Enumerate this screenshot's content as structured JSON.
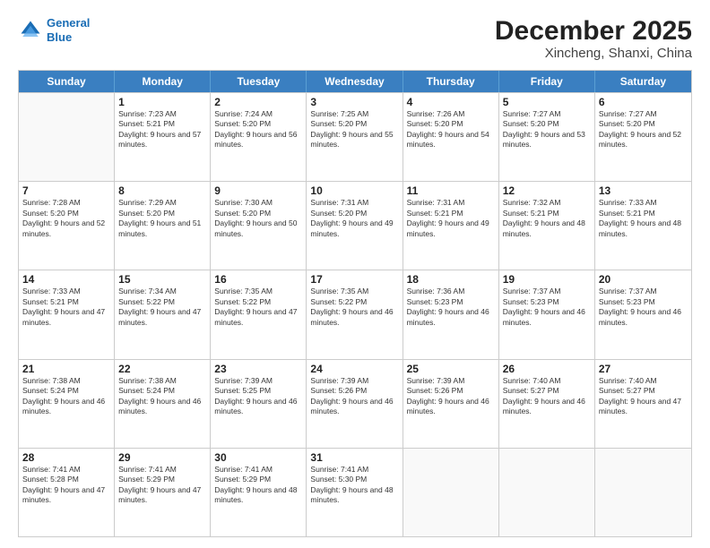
{
  "header": {
    "logo_line1": "General",
    "logo_line2": "Blue",
    "title": "December 2025",
    "subtitle": "Xincheng, Shanxi, China"
  },
  "calendar": {
    "days": [
      "Sunday",
      "Monday",
      "Tuesday",
      "Wednesday",
      "Thursday",
      "Friday",
      "Saturday"
    ],
    "rows": [
      [
        {
          "date": "",
          "sunrise": "",
          "sunset": "",
          "daylight": "",
          "empty": true
        },
        {
          "date": "1",
          "sunrise": "Sunrise: 7:23 AM",
          "sunset": "Sunset: 5:21 PM",
          "daylight": "Daylight: 9 hours and 57 minutes.",
          "empty": false
        },
        {
          "date": "2",
          "sunrise": "Sunrise: 7:24 AM",
          "sunset": "Sunset: 5:20 PM",
          "daylight": "Daylight: 9 hours and 56 minutes.",
          "empty": false
        },
        {
          "date": "3",
          "sunrise": "Sunrise: 7:25 AM",
          "sunset": "Sunset: 5:20 PM",
          "daylight": "Daylight: 9 hours and 55 minutes.",
          "empty": false
        },
        {
          "date": "4",
          "sunrise": "Sunrise: 7:26 AM",
          "sunset": "Sunset: 5:20 PM",
          "daylight": "Daylight: 9 hours and 54 minutes.",
          "empty": false
        },
        {
          "date": "5",
          "sunrise": "Sunrise: 7:27 AM",
          "sunset": "Sunset: 5:20 PM",
          "daylight": "Daylight: 9 hours and 53 minutes.",
          "empty": false
        },
        {
          "date": "6",
          "sunrise": "Sunrise: 7:27 AM",
          "sunset": "Sunset: 5:20 PM",
          "daylight": "Daylight: 9 hours and 52 minutes.",
          "empty": false
        }
      ],
      [
        {
          "date": "7",
          "sunrise": "Sunrise: 7:28 AM",
          "sunset": "Sunset: 5:20 PM",
          "daylight": "Daylight: 9 hours and 52 minutes.",
          "empty": false
        },
        {
          "date": "8",
          "sunrise": "Sunrise: 7:29 AM",
          "sunset": "Sunset: 5:20 PM",
          "daylight": "Daylight: 9 hours and 51 minutes.",
          "empty": false
        },
        {
          "date": "9",
          "sunrise": "Sunrise: 7:30 AM",
          "sunset": "Sunset: 5:20 PM",
          "daylight": "Daylight: 9 hours and 50 minutes.",
          "empty": false
        },
        {
          "date": "10",
          "sunrise": "Sunrise: 7:31 AM",
          "sunset": "Sunset: 5:20 PM",
          "daylight": "Daylight: 9 hours and 49 minutes.",
          "empty": false
        },
        {
          "date": "11",
          "sunrise": "Sunrise: 7:31 AM",
          "sunset": "Sunset: 5:21 PM",
          "daylight": "Daylight: 9 hours and 49 minutes.",
          "empty": false
        },
        {
          "date": "12",
          "sunrise": "Sunrise: 7:32 AM",
          "sunset": "Sunset: 5:21 PM",
          "daylight": "Daylight: 9 hours and 48 minutes.",
          "empty": false
        },
        {
          "date": "13",
          "sunrise": "Sunrise: 7:33 AM",
          "sunset": "Sunset: 5:21 PM",
          "daylight": "Daylight: 9 hours and 48 minutes.",
          "empty": false
        }
      ],
      [
        {
          "date": "14",
          "sunrise": "Sunrise: 7:33 AM",
          "sunset": "Sunset: 5:21 PM",
          "daylight": "Daylight: 9 hours and 47 minutes.",
          "empty": false
        },
        {
          "date": "15",
          "sunrise": "Sunrise: 7:34 AM",
          "sunset": "Sunset: 5:22 PM",
          "daylight": "Daylight: 9 hours and 47 minutes.",
          "empty": false
        },
        {
          "date": "16",
          "sunrise": "Sunrise: 7:35 AM",
          "sunset": "Sunset: 5:22 PM",
          "daylight": "Daylight: 9 hours and 47 minutes.",
          "empty": false
        },
        {
          "date": "17",
          "sunrise": "Sunrise: 7:35 AM",
          "sunset": "Sunset: 5:22 PM",
          "daylight": "Daylight: 9 hours and 46 minutes.",
          "empty": false
        },
        {
          "date": "18",
          "sunrise": "Sunrise: 7:36 AM",
          "sunset": "Sunset: 5:23 PM",
          "daylight": "Daylight: 9 hours and 46 minutes.",
          "empty": false
        },
        {
          "date": "19",
          "sunrise": "Sunrise: 7:37 AM",
          "sunset": "Sunset: 5:23 PM",
          "daylight": "Daylight: 9 hours and 46 minutes.",
          "empty": false
        },
        {
          "date": "20",
          "sunrise": "Sunrise: 7:37 AM",
          "sunset": "Sunset: 5:23 PM",
          "daylight": "Daylight: 9 hours and 46 minutes.",
          "empty": false
        }
      ],
      [
        {
          "date": "21",
          "sunrise": "Sunrise: 7:38 AM",
          "sunset": "Sunset: 5:24 PM",
          "daylight": "Daylight: 9 hours and 46 minutes.",
          "empty": false
        },
        {
          "date": "22",
          "sunrise": "Sunrise: 7:38 AM",
          "sunset": "Sunset: 5:24 PM",
          "daylight": "Daylight: 9 hours and 46 minutes.",
          "empty": false
        },
        {
          "date": "23",
          "sunrise": "Sunrise: 7:39 AM",
          "sunset": "Sunset: 5:25 PM",
          "daylight": "Daylight: 9 hours and 46 minutes.",
          "empty": false
        },
        {
          "date": "24",
          "sunrise": "Sunrise: 7:39 AM",
          "sunset": "Sunset: 5:26 PM",
          "daylight": "Daylight: 9 hours and 46 minutes.",
          "empty": false
        },
        {
          "date": "25",
          "sunrise": "Sunrise: 7:39 AM",
          "sunset": "Sunset: 5:26 PM",
          "daylight": "Daylight: 9 hours and 46 minutes.",
          "empty": false
        },
        {
          "date": "26",
          "sunrise": "Sunrise: 7:40 AM",
          "sunset": "Sunset: 5:27 PM",
          "daylight": "Daylight: 9 hours and 46 minutes.",
          "empty": false
        },
        {
          "date": "27",
          "sunrise": "Sunrise: 7:40 AM",
          "sunset": "Sunset: 5:27 PM",
          "daylight": "Daylight: 9 hours and 47 minutes.",
          "empty": false
        }
      ],
      [
        {
          "date": "28",
          "sunrise": "Sunrise: 7:41 AM",
          "sunset": "Sunset: 5:28 PM",
          "daylight": "Daylight: 9 hours and 47 minutes.",
          "empty": false
        },
        {
          "date": "29",
          "sunrise": "Sunrise: 7:41 AM",
          "sunset": "Sunset: 5:29 PM",
          "daylight": "Daylight: 9 hours and 47 minutes.",
          "empty": false
        },
        {
          "date": "30",
          "sunrise": "Sunrise: 7:41 AM",
          "sunset": "Sunset: 5:29 PM",
          "daylight": "Daylight: 9 hours and 48 minutes.",
          "empty": false
        },
        {
          "date": "31",
          "sunrise": "Sunrise: 7:41 AM",
          "sunset": "Sunset: 5:30 PM",
          "daylight": "Daylight: 9 hours and 48 minutes.",
          "empty": false
        },
        {
          "date": "",
          "sunrise": "",
          "sunset": "",
          "daylight": "",
          "empty": true
        },
        {
          "date": "",
          "sunrise": "",
          "sunset": "",
          "daylight": "",
          "empty": true
        },
        {
          "date": "",
          "sunrise": "",
          "sunset": "",
          "daylight": "",
          "empty": true
        }
      ]
    ]
  }
}
